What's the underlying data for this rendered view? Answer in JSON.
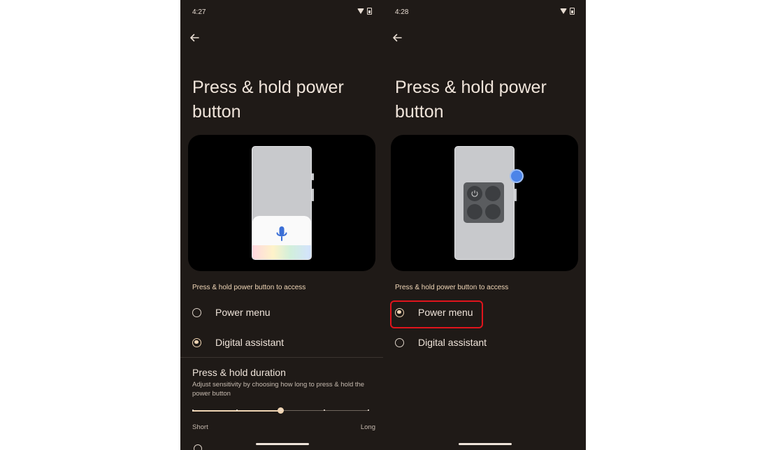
{
  "colors": {
    "screen_background": "#1f1a17",
    "accent": "#f0d5b4",
    "highlight": "#e0141c"
  },
  "screens": [
    {
      "status": {
        "time": "4:27",
        "icons": [
          "wifi-icon",
          "battery-icon"
        ]
      },
      "title": "Press & hold power button",
      "illustration": "assistant-sheet-with-mic-icon",
      "section_label": "Press & hold power button to access",
      "options": [
        {
          "label": "Power menu",
          "selected": false
        },
        {
          "label": "Digital assistant",
          "selected": true
        }
      ],
      "duration": {
        "title": "Press & hold duration",
        "description": "Adjust sensitivity by choosing how long to press & hold the power button",
        "slider_min_label": "Short",
        "slider_max_label": "Long",
        "slider_steps": 5,
        "slider_value_fraction": 0.5
      }
    },
    {
      "status": {
        "time": "4:28",
        "icons": [
          "wifi-icon",
          "battery-icon"
        ]
      },
      "title": "Press & hold power button",
      "illustration": "power-menu-grid-with-power-icon",
      "section_label": "Press & hold power button to access",
      "options": [
        {
          "label": "Power menu",
          "selected": true,
          "highlighted": true
        },
        {
          "label": "Digital assistant",
          "selected": false
        }
      ]
    }
  ]
}
